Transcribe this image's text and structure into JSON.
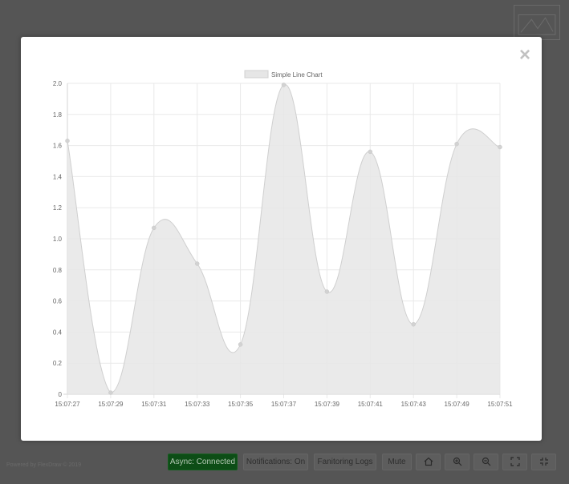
{
  "modal": {
    "close_label": "×"
  },
  "footer": {
    "powered_by": "Powered by FlexDraw © 2019",
    "buttons": {
      "async": "Async: Connected",
      "notifications": "Notifications: On",
      "logs": "Fanitoring Logs",
      "mute": "Mute"
    },
    "icons": [
      "home-icon",
      "zoom-in-icon",
      "zoom-out-icon",
      "expand-icon",
      "compress-icon"
    ]
  },
  "colors": {
    "overlay": "#555555",
    "line": "#cfcfcf",
    "fill": "#e6e6e6",
    "point": "#d2d2d2",
    "grid": "#e9e9e9",
    "async_button": "#0d4d16"
  },
  "chart_data": {
    "type": "area",
    "legend": [
      "Simple Line Chart"
    ],
    "legend_position": "top",
    "grid": true,
    "series": [
      {
        "name": "Simple Line Chart",
        "values": [
          1.63,
          0.01,
          1.07,
          0.84,
          0.32,
          1.99,
          0.66,
          1.56,
          0.45,
          1.61,
          1.59
        ]
      }
    ],
    "categories": [
      "15:07:27",
      "15:07:29",
      "15:07:31",
      "15:07:33",
      "15:07:35",
      "15:07:37",
      "15:07:39",
      "15:07:41",
      "15:07:43",
      "15:07:49",
      "15:07:51"
    ],
    "y_ticks": [
      "2.0",
      "1.8",
      "1.6",
      "1.4",
      "1.2",
      "1.0",
      "0.8",
      "0.6",
      "0.4",
      "0.2",
      "0"
    ],
    "ylim": [
      0,
      2.0
    ]
  }
}
